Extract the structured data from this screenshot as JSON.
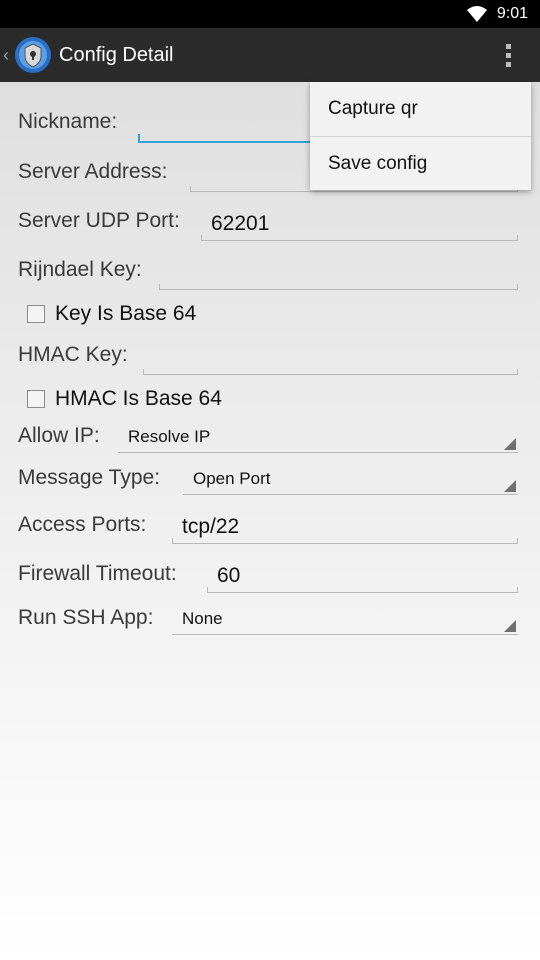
{
  "status_bar": {
    "time": "9:01"
  },
  "action_bar": {
    "title": "Config Detail"
  },
  "form": {
    "nickname": {
      "label": "Nickname:",
      "value": ""
    },
    "server_address": {
      "label": "Server Address:",
      "value": ""
    },
    "server_udp_port": {
      "label": "Server UDP Port:",
      "value": "62201"
    },
    "rijndael_key": {
      "label": "Rijndael Key:",
      "value": ""
    },
    "key_is_base64": {
      "label": "Key Is Base 64",
      "checked": false
    },
    "hmac_key": {
      "label": "HMAC Key:",
      "value": ""
    },
    "hmac_is_base64": {
      "label": "HMAC Is Base 64",
      "checked": false
    },
    "allow_ip": {
      "label": "Allow IP:",
      "selected": "Resolve IP"
    },
    "message_type": {
      "label": "Message Type:",
      "selected": "Open Port"
    },
    "access_ports": {
      "label": "Access Ports:",
      "value": "tcp/22"
    },
    "firewall_timeout": {
      "label": "Firewall Timeout:",
      "value": "60"
    },
    "run_ssh_app": {
      "label": "Run SSH App:",
      "selected": "None"
    }
  },
  "overflow_menu": {
    "items": [
      {
        "label": "Capture qr"
      },
      {
        "label": "Save config"
      }
    ]
  },
  "colors": {
    "focus_accent": "#2fa3d6",
    "action_bar": "#2b2b2b",
    "status_bar": "#000000"
  }
}
